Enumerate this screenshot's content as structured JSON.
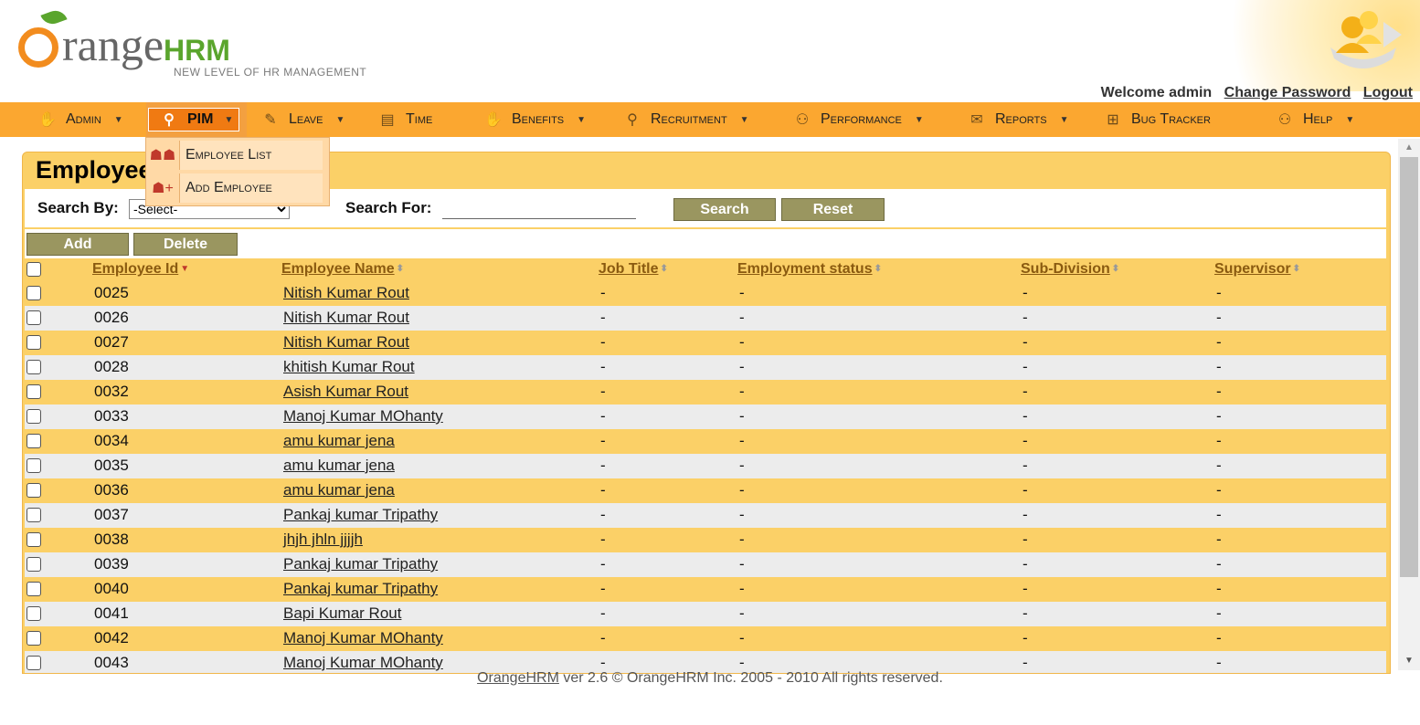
{
  "header": {
    "logo_main": "range",
    "logo_hrm": "HRM",
    "logo_tagline": "NEW LEVEL OF HR MANAGEMENT",
    "welcome": "Welcome admin",
    "change_password": "Change Password",
    "logout": "Logout"
  },
  "menu": {
    "items": [
      {
        "label": "Admin",
        "icon": "admin-icon"
      },
      {
        "label": "PIM",
        "icon": "pim-icon"
      },
      {
        "label": "Leave",
        "icon": "leave-icon"
      },
      {
        "label": "Time",
        "icon": "time-icon"
      },
      {
        "label": "Benefits",
        "icon": "benefits-icon"
      },
      {
        "label": "Recruitment",
        "icon": "recruitment-icon"
      },
      {
        "label": "Performance",
        "icon": "performance-icon"
      },
      {
        "label": "Reports",
        "icon": "reports-icon"
      },
      {
        "label": "Bug Tracker",
        "icon": "bug-tracker-icon"
      },
      {
        "label": "Help",
        "icon": "help-icon"
      }
    ],
    "pim_dropdown": [
      {
        "label": "Employee List",
        "icon": "employee-list-icon"
      },
      {
        "label": "Add Employee",
        "icon": "add-employee-icon"
      }
    ]
  },
  "page": {
    "title": "Employee",
    "search_by_label": "Search By:",
    "search_select_value": "-Select-",
    "search_for_label": "Search For:",
    "search_input_value": "",
    "search_button": "Search",
    "reset_button": "Reset",
    "add_button": "Add",
    "delete_button": "Delete"
  },
  "table": {
    "columns": [
      "Employee Id",
      "Employee Name",
      "Job Title",
      "Employment status",
      "Sub-Division",
      "Supervisor"
    ],
    "rows": [
      {
        "id": "0025",
        "name": "Nitish Kumar Rout",
        "job": "-",
        "status": "-",
        "subdiv": "-",
        "supervisor": "-"
      },
      {
        "id": "0026",
        "name": "Nitish Kumar Rout",
        "job": "-",
        "status": "-",
        "subdiv": "-",
        "supervisor": "-"
      },
      {
        "id": "0027",
        "name": "Nitish Kumar Rout",
        "job": "-",
        "status": "-",
        "subdiv": "-",
        "supervisor": "-"
      },
      {
        "id": "0028",
        "name": "khitish Kumar Rout",
        "job": "-",
        "status": "-",
        "subdiv": "-",
        "supervisor": "-"
      },
      {
        "id": "0032",
        "name": "Asish Kumar Rout",
        "job": "-",
        "status": "-",
        "subdiv": "-",
        "supervisor": "-"
      },
      {
        "id": "0033",
        "name": "Manoj Kumar MOhanty",
        "job": "-",
        "status": "-",
        "subdiv": "-",
        "supervisor": "-"
      },
      {
        "id": "0034",
        "name": "amu kumar jena",
        "job": "-",
        "status": "-",
        "subdiv": "-",
        "supervisor": "-"
      },
      {
        "id": "0035",
        "name": "amu kumar jena",
        "job": "-",
        "status": "-",
        "subdiv": "-",
        "supervisor": "-"
      },
      {
        "id": "0036",
        "name": "amu kumar jena",
        "job": "-",
        "status": "-",
        "subdiv": "-",
        "supervisor": "-"
      },
      {
        "id": "0037",
        "name": "Pankaj kumar Tripathy",
        "job": "-",
        "status": "-",
        "subdiv": "-",
        "supervisor": "-"
      },
      {
        "id": "0038",
        "name": "jhjh jhln jjjjh",
        "job": "-",
        "status": "-",
        "subdiv": "-",
        "supervisor": "-"
      },
      {
        "id": "0039",
        "name": "Pankaj kumar Tripathy",
        "job": "-",
        "status": "-",
        "subdiv": "-",
        "supervisor": "-"
      },
      {
        "id": "0040",
        "name": "Pankaj kumar Tripathy",
        "job": "-",
        "status": "-",
        "subdiv": "-",
        "supervisor": "-"
      },
      {
        "id": "0041",
        "name": "Bapi Kumar Rout",
        "job": "-",
        "status": "-",
        "subdiv": "-",
        "supervisor": "-"
      },
      {
        "id": "0042",
        "name": "Manoj Kumar MOhanty",
        "job": "-",
        "status": "-",
        "subdiv": "-",
        "supervisor": "-"
      },
      {
        "id": "0043",
        "name": "Manoj Kumar MOhanty",
        "job": "-",
        "status": "-",
        "subdiv": "-",
        "supervisor": "-"
      }
    ]
  },
  "footer": {
    "link": "OrangeHRM",
    "text": " ver 2.6 © OrangeHRM Inc. 2005 - 2010 All rights reserved."
  },
  "colors": {
    "menu_bg": "#fba730",
    "panel_bg": "#fbd067",
    "button_bg": "#9a9660",
    "logo_orange": "#f28c1e",
    "logo_green": "#5aa52d"
  }
}
